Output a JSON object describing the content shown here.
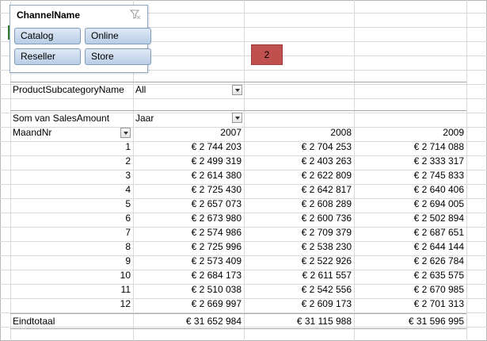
{
  "slicer": {
    "title": "ChannelName",
    "buttons": [
      "Catalog",
      "Online",
      "Reseller",
      "Store"
    ]
  },
  "marker_label": "2",
  "report_filter": {
    "field": "ProductSubcategoryName",
    "value": "All"
  },
  "pivot": {
    "values_label": "Som van SalesAmount",
    "column_field": "Jaar",
    "row_field": "MaandNr",
    "years": [
      "2007",
      "2008",
      "2009"
    ],
    "rows": [
      {
        "month": "1",
        "v": [
          "€ 2 744 203",
          "€ 2 704 253",
          "€ 2 714 088"
        ]
      },
      {
        "month": "2",
        "v": [
          "€ 2 499 319",
          "€ 2 403 263",
          "€ 2 333 317"
        ]
      },
      {
        "month": "3",
        "v": [
          "€ 2 614 380",
          "€ 2 622 809",
          "€ 2 745 833"
        ]
      },
      {
        "month": "4",
        "v": [
          "€ 2 725 430",
          "€ 2 642 817",
          "€ 2 640 406"
        ]
      },
      {
        "month": "5",
        "v": [
          "€ 2 657 073",
          "€ 2 608 289",
          "€ 2 694 005"
        ]
      },
      {
        "month": "6",
        "v": [
          "€ 2 673 980",
          "€ 2 600 736",
          "€ 2 502 894"
        ]
      },
      {
        "month": "7",
        "v": [
          "€ 2 574 986",
          "€ 2 709 379",
          "€ 2 687 651"
        ]
      },
      {
        "month": "8",
        "v": [
          "€ 2 725 996",
          "€ 2 538 230",
          "€ 2 644 144"
        ]
      },
      {
        "month": "9",
        "v": [
          "€ 2 573 409",
          "€ 2 522 926",
          "€ 2 626 784"
        ]
      },
      {
        "month": "10",
        "v": [
          "€ 2 684 173",
          "€ 2 611 557",
          "€ 2 635 575"
        ]
      },
      {
        "month": "11",
        "v": [
          "€ 2 510 038",
          "€ 2 542 556",
          "€ 2 670 985"
        ]
      },
      {
        "month": "12",
        "v": [
          "€ 2 669 997",
          "€ 2 609 173",
          "€ 2 701 313"
        ]
      }
    ],
    "total_label": "Eindtotaal",
    "totals": [
      "€ 31 652 984",
      "€ 31 115 988",
      "€ 31 596 995"
    ]
  },
  "colors": {
    "slicer_button": "#c6d7ee",
    "marker": "#c0504d",
    "gridline": "#d9d9d9"
  }
}
